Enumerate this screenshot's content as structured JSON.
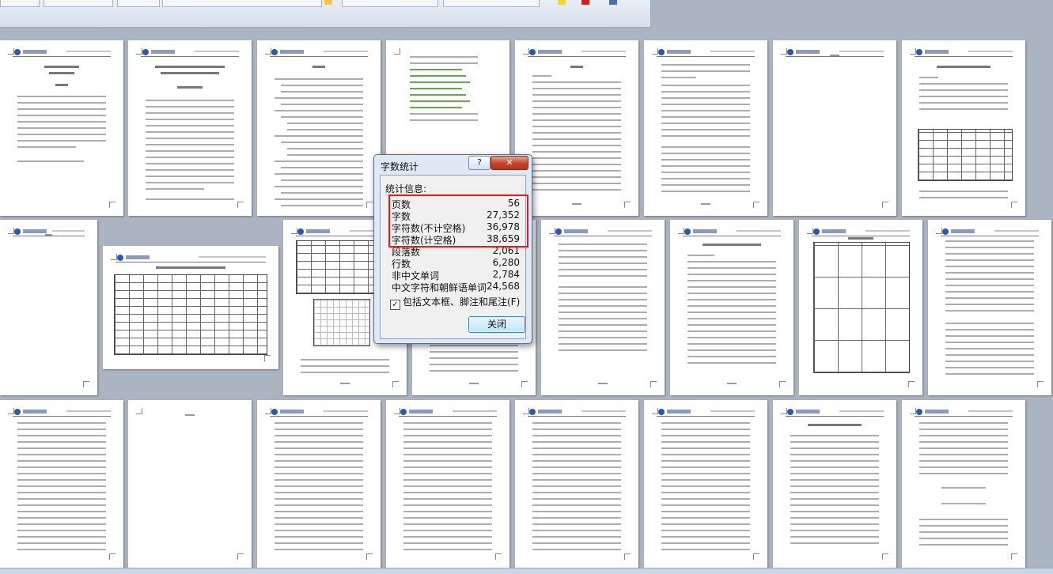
{
  "dialog": {
    "title": "字数统计",
    "help_label": "?",
    "close_icon_label": "✕",
    "group_label": "统计信息:",
    "stats": [
      {
        "label": "页数",
        "value": "56"
      },
      {
        "label": "字数",
        "value": "27,352"
      },
      {
        "label": "字符数(不计空格)",
        "value": "36,978"
      },
      {
        "label": "字符数(计空格)",
        "value": "38,659"
      },
      {
        "label": "段落数",
        "value": "2,061"
      },
      {
        "label": "行数",
        "value": "6,280"
      },
      {
        "label": "非中文单词",
        "value": "2,784"
      },
      {
        "label": "中文字符和朝鲜语单词",
        "value": "24,568"
      }
    ],
    "checkbox_label": "包括文本框、脚注和尾注(F)",
    "checkbox_checked": true,
    "close_button_label": "关闭",
    "highlight_color": "#e31d1d"
  },
  "colors": {
    "workspace": "#abb4c1",
    "dialog_bg": "#dfe9f5",
    "close_red": "#c4442b"
  }
}
